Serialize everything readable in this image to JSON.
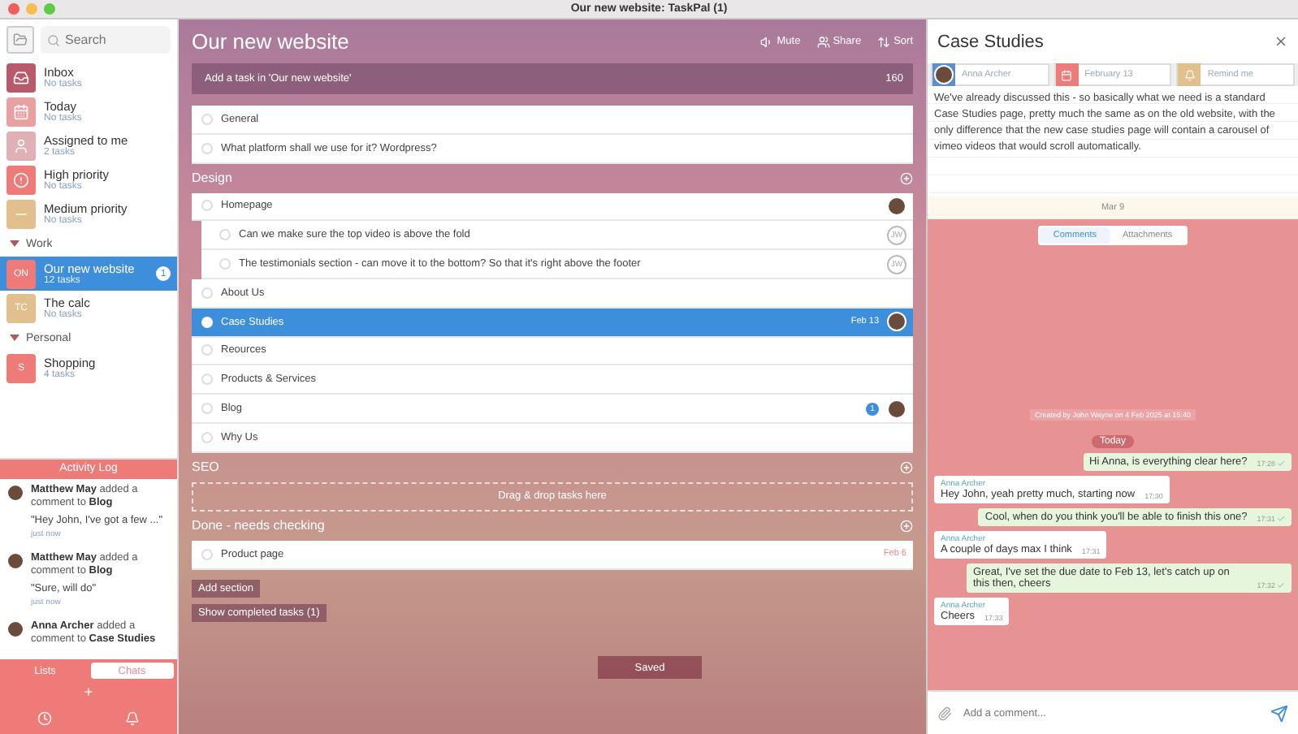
{
  "window": {
    "title": "Our new website: TaskPal (1)"
  },
  "sidebar": {
    "search": {
      "placeholder": "Search"
    },
    "smart_lists": [
      {
        "label": "Inbox",
        "subtitle": "No tasks",
        "color": "#b85a6a"
      },
      {
        "label": "Today",
        "subtitle": "No tasks",
        "color": "#e8a0a0"
      },
      {
        "label": "Assigned to me",
        "subtitle": "2 tasks",
        "color": "#e0b0b4"
      },
      {
        "label": "High priority",
        "subtitle": "No tasks",
        "color": "#ee7b78"
      },
      {
        "label": "Medium priority",
        "subtitle": "No tasks",
        "color": "#e2c08e"
      }
    ],
    "groups": [
      {
        "name": "Work",
        "expanded": true,
        "lists": [
          {
            "abbr": "ON",
            "label": "Our new website",
            "subtitle": "12 tasks",
            "color": "#ee7b78",
            "selected": true,
            "badge": "1"
          },
          {
            "abbr": "TC",
            "label": "The calc",
            "subtitle": "No tasks",
            "color": "#e2c08e",
            "selected": false
          }
        ]
      },
      {
        "name": "Personal",
        "expanded": true,
        "lists": [
          {
            "abbr": "S",
            "label": "Shopping",
            "subtitle": "4 tasks",
            "color": "#ee7b78",
            "selected": false
          }
        ]
      }
    ]
  },
  "activity_log": {
    "title": "Activity Log",
    "entries": [
      {
        "author": "Matthew May",
        "action": "added a comment to",
        "target": "Blog",
        "quote": "\"Hey John, I've got a few ...\"",
        "time": "just now"
      },
      {
        "author": "Matthew May",
        "action": "added a comment to",
        "target": "Blog",
        "quote": "\"Sure, will do\"",
        "time": "just now"
      },
      {
        "author": "Anna Archer",
        "action": "added a comment to",
        "target": "Case Studies"
      }
    ],
    "tabs": [
      {
        "label": "Lists",
        "selected": true
      },
      {
        "label": "Chats",
        "selected": false
      }
    ],
    "add_label": "+"
  },
  "main": {
    "title": "Our new website",
    "actions": [
      {
        "kind": "mute",
        "label": "Mute"
      },
      {
        "kind": "share",
        "label": "Share"
      },
      {
        "kind": "sort",
        "label": "Sort"
      }
    ],
    "add_task": {
      "placeholder": "Add a task in 'Our new website'",
      "counter": "160"
    },
    "sections": [
      {
        "tasks": [
          {
            "label": "General",
            "selected": false
          },
          {
            "label": "What platform shall we use for it? Wordpress?",
            "selected": false
          }
        ]
      },
      {
        "title": "Design",
        "tasks": [
          {
            "label": "Homepage",
            "selected": false,
            "assignee": {
              "kind": "photo"
            },
            "children": [
              {
                "label": "Can we make sure the top video is above the fold",
                "selected": false,
                "assignee": {
                  "kind": "initials",
                  "text": "JW"
                }
              },
              {
                "label": "The testimonials section - can move it to the bottom? So that it's right above the footer",
                "selected": false,
                "assignee": {
                  "kind": "initials",
                  "text": "JW"
                }
              }
            ]
          },
          {
            "label": "About Us",
            "selected": false
          },
          {
            "label": "Case Studies",
            "selected": true,
            "date": "Feb 13",
            "assignee": {
              "kind": "photo"
            }
          },
          {
            "label": "Reources",
            "selected": false
          },
          {
            "label": "Products & Services",
            "selected": false
          },
          {
            "label": "Blog",
            "selected": false,
            "badge": "1",
            "assignee": {
              "kind": "photo"
            }
          },
          {
            "label": "Why Us",
            "selected": false
          }
        ]
      },
      {
        "title": "SEO",
        "drop_hint": "Drag & drop tasks here"
      },
      {
        "title": "Done - needs checking",
        "tasks": [
          {
            "label": "Product page",
            "selected": false,
            "date": "Feb 6"
          }
        ]
      }
    ],
    "buttons": [
      "Add section",
      "Show completed tasks (1)"
    ],
    "toast": "Saved"
  },
  "detail": {
    "title": "Case Studies",
    "assignee": "Anna Archer",
    "due_date": "February 13",
    "remind": "Remind me",
    "description": "We've already discussed this - so basically what we need is a standard Case Studies page, pretty much the same as on the old website, with the only difference that the new case studies page will contain a carousel of vimeo videos that would scroll automatically.",
    "footer": "Mar 9",
    "tabs": [
      {
        "label": "Comments",
        "selected": true
      },
      {
        "label": "Attachments",
        "selected": false
      }
    ],
    "created": "Created by John Wayne on 4 Feb 2025 at 15:40",
    "day": "Today",
    "messages": [
      {
        "kind": "sent",
        "text": "Hi Anna, is everything clear here?",
        "time": "17:28"
      },
      {
        "kind": "received",
        "author": "Anna Archer",
        "text": "Hey John, yeah pretty much, starting now",
        "time": "17:30"
      },
      {
        "kind": "sent",
        "text": "Cool, when do you think you'll be able to finish this one?",
        "time": "17:31"
      },
      {
        "kind": "received",
        "author": "Anna Archer",
        "text": "A couple of days max I think",
        "time": "17:31"
      },
      {
        "kind": "sent",
        "text": "Great, I've set the due date to Feb 13, let's catch up on this then, cheers",
        "time": "17:32"
      },
      {
        "kind": "received",
        "author": "Anna Archer",
        "text": "Cheers",
        "time": "17:33"
      }
    ],
    "comment": {
      "placeholder": "Add a comment..."
    }
  }
}
